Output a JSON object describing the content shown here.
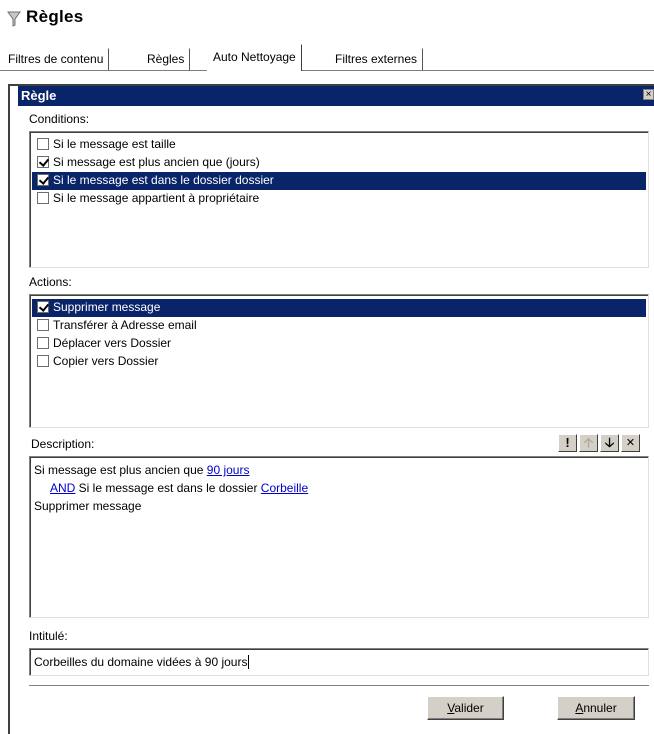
{
  "page": {
    "title": "Règles"
  },
  "tabs": [
    {
      "label": "Filtres de contenu",
      "active": false
    },
    {
      "label": "Règles",
      "active": false
    },
    {
      "label": "Auto Nettoyage",
      "active": true
    },
    {
      "label": "Filtres externes",
      "active": false
    }
  ],
  "rule": {
    "header": "Règle",
    "conditions_label": "Conditions:",
    "conditions": [
      {
        "label": "Si le message est taille",
        "checked": false,
        "selected": false
      },
      {
        "label": "Si message est plus ancien que (jours)",
        "checked": true,
        "selected": false
      },
      {
        "label": "Si le message est dans le dossier dossier",
        "checked": true,
        "selected": true
      },
      {
        "label": "Si le message appartient à propriétaire",
        "checked": false,
        "selected": false
      }
    ],
    "actions_label": "Actions:",
    "actions": [
      {
        "label": "Supprimer message",
        "checked": true,
        "selected": true
      },
      {
        "label": "Transférer à Adresse email",
        "checked": false,
        "selected": false
      },
      {
        "label": "Déplacer vers Dossier",
        "checked": false,
        "selected": false
      },
      {
        "label": "Copier vers Dossier",
        "checked": false,
        "selected": false
      }
    ],
    "description_label": "Description:",
    "description": {
      "line1_text": "Si message est plus ancien que ",
      "line1_link": "90 jours",
      "line2_link": "AND",
      "line2_text": " Si le message est dans le dossier ",
      "line2_folder_link": "Corbeille",
      "line3_text": "Supprimer message"
    },
    "toolbar": {
      "important": "!",
      "up": "🡡",
      "down": "🡣",
      "delete": "✕"
    },
    "title_label": "Intitulé:",
    "title_value": "Corbeilles du domaine vidées à 90 jours",
    "close_glyph": "×"
  },
  "buttons": {
    "validate": {
      "mnemonic": "V",
      "rest": "alider"
    },
    "cancel": {
      "mnemonic": "A",
      "rest": "nnuler"
    }
  }
}
